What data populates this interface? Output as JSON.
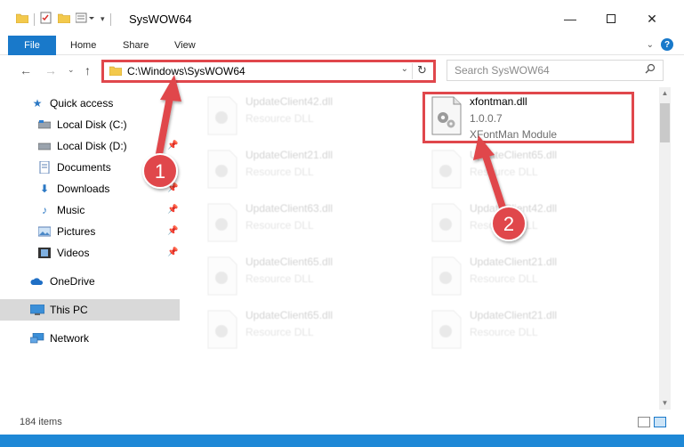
{
  "window": {
    "title": "SysWOW64",
    "controls": [
      "minimize-icon",
      "maximize-icon",
      "close-icon"
    ]
  },
  "ribbon": {
    "tabs": [
      "File",
      "Home",
      "Share",
      "View"
    ]
  },
  "address": {
    "path": "C:\\Windows\\SysWOW64"
  },
  "search": {
    "placeholder": "Search SysWOW64"
  },
  "sidebar": {
    "items": [
      {
        "label": "Quick access",
        "icon": "star-icon"
      },
      {
        "label": "Local Disk (C:)",
        "icon": "drive-icon"
      },
      {
        "label": "Local Disk (D:)",
        "icon": "drive-icon"
      },
      {
        "label": "Documents",
        "icon": "documents-icon"
      },
      {
        "label": "Downloads",
        "icon": "downloads-icon"
      },
      {
        "label": "Music",
        "icon": "music-icon"
      },
      {
        "label": "Pictures",
        "icon": "pictures-icon"
      },
      {
        "label": "Videos",
        "icon": "videos-icon"
      },
      {
        "label": "OneDrive",
        "icon": "cloud-icon"
      },
      {
        "label": "This PC",
        "icon": "computer-icon"
      },
      {
        "label": "Network",
        "icon": "network-icon"
      }
    ],
    "selected": "This PC"
  },
  "files": {
    "highlighted": {
      "name": "xfontman.dll",
      "version": "1.0.0.7",
      "description": "XFontMan Module"
    },
    "left_column": [
      {
        "name": "UpdateClient42.dll",
        "description": "Resource DLL"
      },
      {
        "name": "UpdateClient21.dll",
        "description": "Resource DLL"
      },
      {
        "name": "UpdateClient63.dll",
        "description": "Resource DLL"
      },
      {
        "name": "UpdateClient65.dll",
        "description": "Resource DLL"
      },
      {
        "name": "UpdateClient65.dll",
        "description": "Resource DLL"
      }
    ],
    "right_column": [
      {
        "name": "UpdateClient65.dll",
        "description": "Resource DLL"
      },
      {
        "name": "UpdateClient42.dll",
        "description": "Resource DLL"
      },
      {
        "name": "UpdateClient21.dll",
        "description": "Resource DLL"
      },
      {
        "name": "UpdateClient21.dll",
        "description": "Resource DLL"
      }
    ]
  },
  "status": {
    "item_count": "184 items"
  },
  "annotations": {
    "step1": "1",
    "step2": "2"
  },
  "colors": {
    "accent": "#1979ca",
    "highlight_red": "#e0474c",
    "selected_bg": "#d9d9d9"
  }
}
